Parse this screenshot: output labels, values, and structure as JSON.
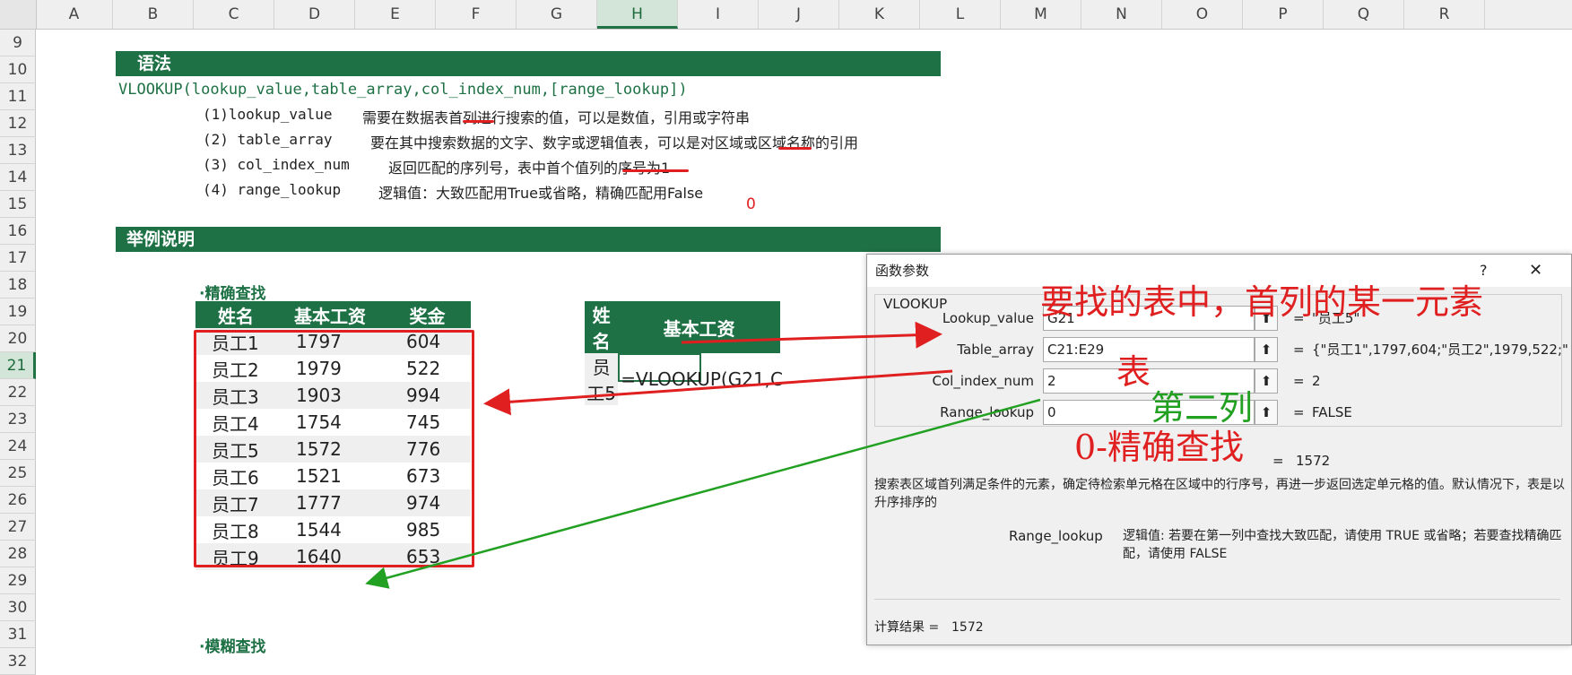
{
  "columns": [
    "A",
    "B",
    "C",
    "D",
    "E",
    "F",
    "G",
    "H",
    "I",
    "J",
    "K",
    "L",
    "M",
    "N",
    "O",
    "P",
    "Q",
    "R"
  ],
  "selected_column": "H",
  "rows": [
    "9",
    "10",
    "11",
    "12",
    "13",
    "14",
    "15",
    "16",
    "17",
    "18",
    "19",
    "20",
    "21",
    "22",
    "23",
    "24",
    "25",
    "26",
    "27",
    "28",
    "29",
    "30",
    "31",
    "32"
  ],
  "selected_row": "21",
  "sheet": {
    "syntax_header": "语法",
    "formula_syntax": "VLOOKUP(lookup_value,table_array,col_index_num,[range_lookup])",
    "params": [
      {
        "name": "(1)lookup_value",
        "desc_a": "需要在数据表",
        "desc_u": "首列",
        "desc_b": "进行搜索的值，可以是数值，引用或字符串"
      },
      {
        "name": "(2) table_array",
        "desc_a": "要在其中搜索数据的文字、数字或逻辑值表，可以是对",
        "desc_u": "区域",
        "desc_b": "或区域名称的引用"
      },
      {
        "name": "(3) col_index_num",
        "desc_a": "返回匹配的序列号，表中首个值",
        "desc_u": "列的序号",
        "desc_b": "为1"
      },
      {
        "name": "(4) range_lookup",
        "desc_a": "逻辑值：大致匹配用True或省略，精确匹配用False",
        "desc_u": "",
        "desc_b": ""
      }
    ],
    "zero_mark": "0",
    "example_header": "举例说明",
    "exact_lookup_label": "·精确查找",
    "table_headers": [
      "姓名",
      "基本工资",
      "奖金"
    ],
    "table_rows": [
      [
        "员工1",
        "1797",
        "604"
      ],
      [
        "员工2",
        "1979",
        "522"
      ],
      [
        "员工3",
        "1903",
        "994"
      ],
      [
        "员工4",
        "1754",
        "745"
      ],
      [
        "员工5",
        "1572",
        "776"
      ],
      [
        "员工6",
        "1521",
        "673"
      ],
      [
        "员工7",
        "1777",
        "974"
      ],
      [
        "员工8",
        "1544",
        "985"
      ],
      [
        "员工9",
        "1640",
        "653"
      ]
    ],
    "lookup_headers": [
      "姓名",
      "基本工资"
    ],
    "lookup_name": "员工5",
    "lookup_formula": "=VLOOKUP(G21,C",
    "partial_row32": "·模糊查找"
  },
  "dialog": {
    "title": "函数参数",
    "help": "?",
    "close": "✕",
    "function_name": "VLOOKUP",
    "args": [
      {
        "label": "Lookup_value",
        "value": "G21",
        "result": "\"员工5\""
      },
      {
        "label": "Table_array",
        "value": "C21:E29",
        "result": "{\"员工1\",1797,604;\"员工2\",1979,522;\""
      },
      {
        "label": "Col_index_num",
        "value": "2",
        "result": "2"
      },
      {
        "label": "Range_lookup",
        "value": "0",
        "result": "FALSE"
      }
    ],
    "eq": "=",
    "formula_result_inline": "1572",
    "description": "搜索表区域首列满足条件的元素，确定待检索单元格在区域中的行序号，再进一步返回选定单元格的值。默认情况下，表是以升序排序的",
    "param_help_label": "Range_lookup",
    "param_help_text": "逻辑值: 若要在第一列中查找大致匹配，请使用 TRUE 或省略；若要查找精确匹配，请使用 FALSE",
    "calc_result_label": "计算结果 =",
    "calc_result_value": "1572"
  },
  "annotations": {
    "lookup_note": "要找的表中，首列的某一元素",
    "table_note": "表",
    "col_note": "第二列",
    "range_note": "0-精确查找",
    "red": "#e02020",
    "green": "#22a022"
  },
  "colors": {
    "accent": "#1e7145",
    "excel_select": "#217346"
  }
}
